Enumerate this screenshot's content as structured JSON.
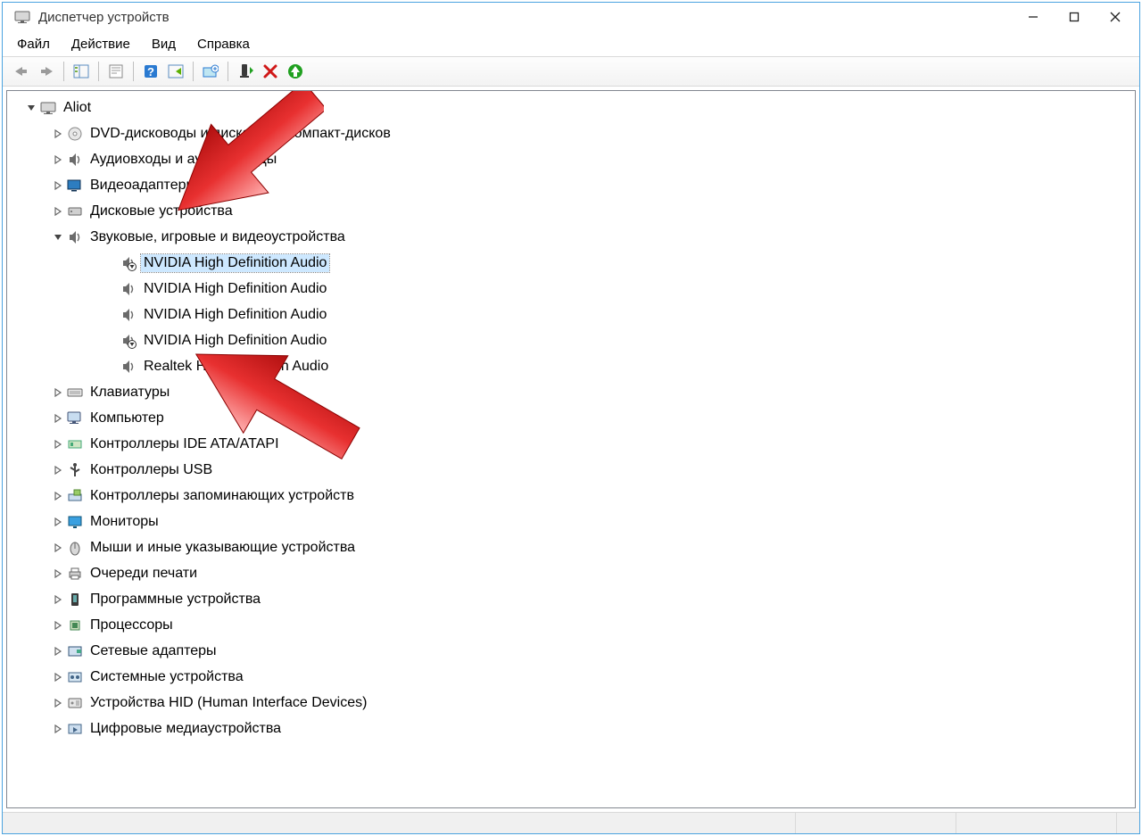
{
  "window": {
    "title": "Диспетчер устройств"
  },
  "menu": {
    "file": "Файл",
    "action": "Действие",
    "view": "Вид",
    "help": "Справка"
  },
  "root": {
    "name": "Aliot"
  },
  "categories": [
    {
      "icon": "disc",
      "label": "DVD-дисководы и дисководы компакт-дисков"
    },
    {
      "icon": "speaker",
      "label": "Аудиовходы и аудиовыходы"
    },
    {
      "icon": "display",
      "label": "Видеоадаптеры"
    },
    {
      "icon": "hdd",
      "label": "Дисковые устройства"
    },
    {
      "icon": "speaker",
      "label": "Звуковые, игровые и видеоустройства",
      "expanded": true,
      "children": [
        {
          "icon": "speaker",
          "disabled": true,
          "label": "NVIDIA High Definition Audio",
          "selected": true
        },
        {
          "icon": "speaker",
          "disabled": false,
          "label": "NVIDIA High Definition Audio"
        },
        {
          "icon": "speaker",
          "disabled": false,
          "label": "NVIDIA High Definition Audio"
        },
        {
          "icon": "speaker",
          "disabled": true,
          "label": "NVIDIA High Definition Audio"
        },
        {
          "icon": "speaker",
          "disabled": false,
          "label": "Realtek High Definition Audio"
        }
      ]
    },
    {
      "icon": "keyboard",
      "label": "Клавиатуры"
    },
    {
      "icon": "computer",
      "label": "Компьютер"
    },
    {
      "icon": "ide",
      "label": "Контроллеры IDE ATA/ATAPI"
    },
    {
      "icon": "usb",
      "label": "Контроллеры USB"
    },
    {
      "icon": "storage",
      "label": "Контроллеры запоминающих устройств"
    },
    {
      "icon": "monitor",
      "label": "Мониторы"
    },
    {
      "icon": "mouse",
      "label": "Мыши и иные указывающие устройства"
    },
    {
      "icon": "printer",
      "label": "Очереди печати"
    },
    {
      "icon": "software",
      "label": "Программные устройства"
    },
    {
      "icon": "cpu",
      "label": "Процессоры"
    },
    {
      "icon": "net",
      "label": "Сетевые адаптеры"
    },
    {
      "icon": "system",
      "label": "Системные устройства"
    },
    {
      "icon": "hid",
      "label": "Устройства HID (Human Interface Devices)"
    },
    {
      "icon": "media",
      "label": "Цифровые медиаустройства"
    }
  ],
  "annotations": [
    {
      "target": "category-4",
      "desc": "red arrow pointing at Звуковые, игровые и видеоустройства"
    },
    {
      "target": "device-4-3",
      "desc": "red arrow pointing at disabled NVIDIA High Definition Audio"
    }
  ]
}
